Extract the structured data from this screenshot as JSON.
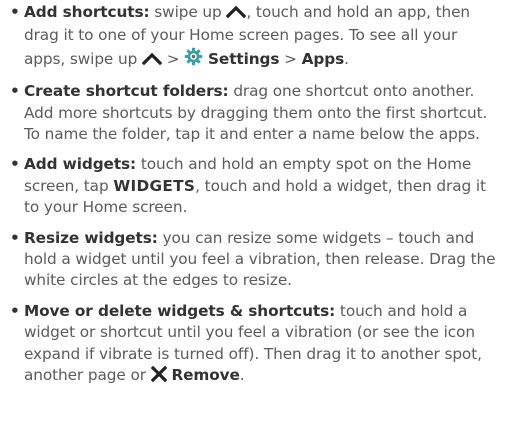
{
  "tips": [
    {
      "term": "Add shortcuts:",
      "t1": "swipe up",
      "t2": ", touch and hold an app, then drag it to one of your Home screen pages. To see all your apps, swipe up",
      "t3": ">",
      "settings": "Settings",
      "t4": ">",
      "apps": "Apps",
      "t5": "."
    },
    {
      "term": "Create shortcut folders:",
      "text": "drag one shortcut onto another. Add more shortcuts by dragging them onto the first shortcut. To name the folder, tap it and enter a name below the apps."
    },
    {
      "term": "Add widgets:",
      "t1": "touch and hold an empty spot on the Home screen, tap",
      "widgets": "WIDGETS",
      "t2": ", touch and hold a widget, then drag it to your Home screen."
    },
    {
      "term": "Resize widgets:",
      "text": "you can resize some widgets – touch and hold a widget until you feel a vibration, then release. Drag the white circles at the edges to resize."
    },
    {
      "term": "Move or delete widgets & shortcuts:",
      "t1": "touch and hold a widget or shortcut until you feel a vibration (or see the icon expand if vibrate is turned off). Then drag it to another spot, another page or",
      "remove": "Remove",
      "t2": "."
    }
  ],
  "icons": {
    "swipe_up": "chevron-up-icon",
    "settings": "gear-icon",
    "remove": "close-icon"
  },
  "colors": {
    "text": "#5b5b5b",
    "bold": "#333333",
    "icon": "#222222",
    "gear": "#3aa0a8"
  }
}
